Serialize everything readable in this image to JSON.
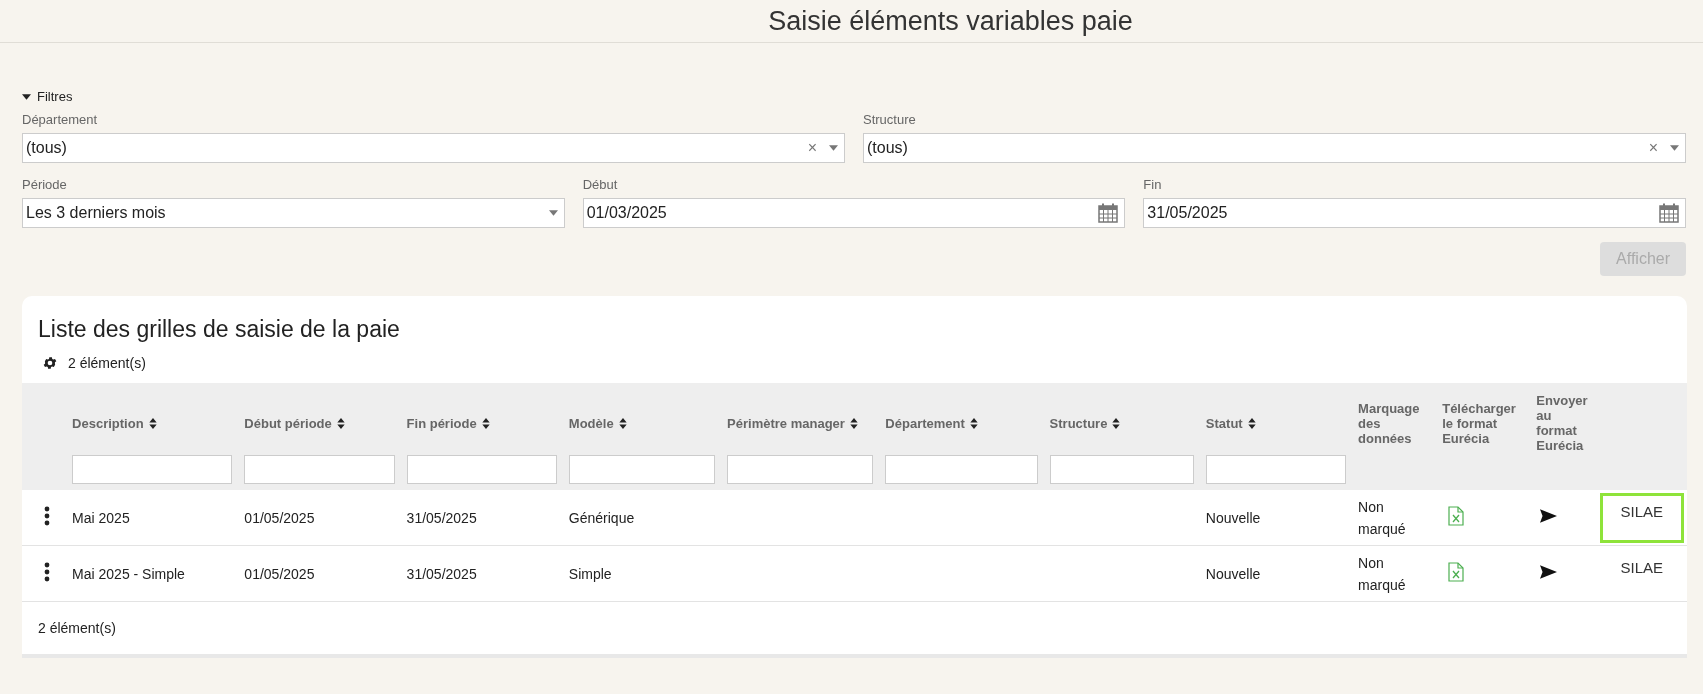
{
  "page": {
    "title": "Saisie éléments variables paie"
  },
  "filters": {
    "toggle_label": "Filtres",
    "expanded": true,
    "fields": [
      {
        "kind": "select",
        "label": "Département",
        "value": "(tous)",
        "clear": "×"
      },
      {
        "kind": "select",
        "label": "Structure",
        "value": "(tous)",
        "clear": "×"
      },
      {
        "kind": "select",
        "label": "Période",
        "value": "Les 3 derniers mois"
      },
      {
        "kind": "date",
        "label": "Début",
        "value": "01/03/2025"
      },
      {
        "kind": "date",
        "label": "Fin",
        "value": "31/05/2025"
      }
    ],
    "submit": {
      "label": "Afficher",
      "disabled": true
    }
  },
  "list": {
    "title": "Liste des grilles de saisie de la paie",
    "count": "2 élément(s)",
    "columns": [
      {
        "label": "Description",
        "sortable": true,
        "filter": true
      },
      {
        "label": "Début période",
        "sortable": true,
        "filter": true
      },
      {
        "label": "Fin période",
        "sortable": true,
        "filter": true
      },
      {
        "label": "Modèle",
        "sortable": true,
        "filter": true
      },
      {
        "label": "Périmètre manager",
        "sortable": true,
        "filter": true
      },
      {
        "label": "Département",
        "sortable": true,
        "filter": true
      },
      {
        "label": "Structure",
        "sortable": true,
        "filter": true
      },
      {
        "label": "Statut",
        "sortable": true,
        "filter": true
      },
      {
        "label": "Marquage des données",
        "sortable": false,
        "filter": false
      },
      {
        "label": "Télécharger le format Eurécia",
        "sortable": false,
        "filter": false
      },
      {
        "label": "Envoyer au format Eurécia",
        "sortable": false,
        "filter": false
      }
    ],
    "rows": [
      {
        "description": "Mai 2025",
        "start": "01/05/2025",
        "end": "31/05/2025",
        "model": "Générique",
        "status": "Nouvelle",
        "marking": "Non marqué",
        "action": "SILAE",
        "focused": true
      },
      {
        "description": "Mai 2025 - Simple",
        "start": "01/05/2025",
        "end": "31/05/2025",
        "model": "Simple",
        "status": "Nouvelle",
        "marking": "Non marqué",
        "action": "SILAE",
        "focused": false
      }
    ],
    "footer_count": "2 élément(s)"
  }
}
